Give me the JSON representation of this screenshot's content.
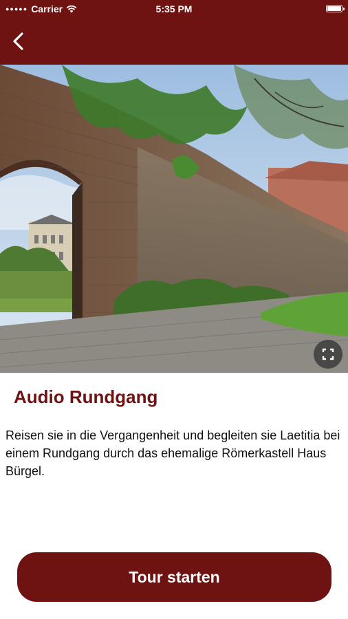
{
  "status_bar": {
    "carrier": "Carrier",
    "time": "5:35 PM"
  },
  "nav": {
    "back_icon": "chevron-left-icon"
  },
  "hero": {
    "fullscreen_icon": "expand-icon"
  },
  "content": {
    "title": "Audio Rundgang",
    "description": "Reisen sie in die Vergangenheit und begleiten sie Laetitia bei einem Rundgang durch das ehemalige Römerkastell Haus Bürgel."
  },
  "cta": {
    "label": "Tour starten"
  },
  "colors": {
    "brand": "#6e1212",
    "text": "#111111",
    "background": "#ffffff"
  }
}
